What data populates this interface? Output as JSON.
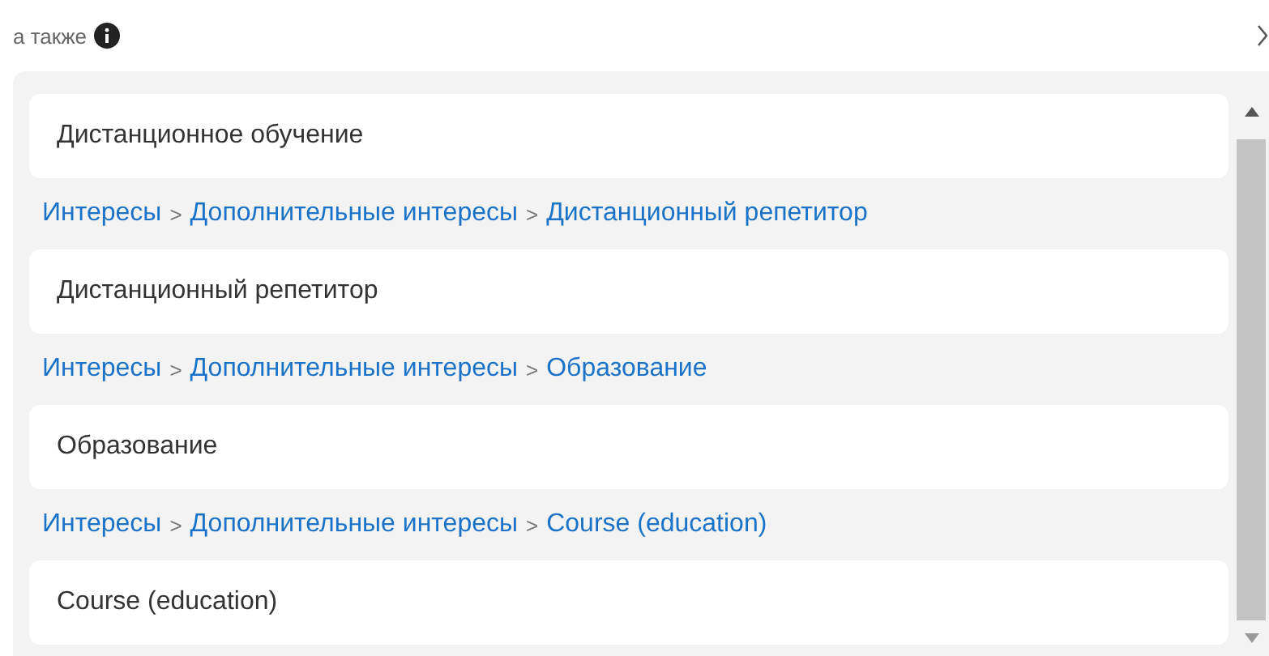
{
  "header": {
    "title": "а также"
  },
  "results": [
    {
      "title": "Дистанционное обучение"
    },
    {
      "path": [
        {
          "kind": "link",
          "text": "Интересы"
        },
        {
          "kind": "sep",
          "text": ">"
        },
        {
          "kind": "link",
          "text": "Дополнительные интересы"
        },
        {
          "kind": "sep",
          "text": ">"
        },
        {
          "kind": "link",
          "text": "Дистанционный репетитор"
        }
      ],
      "title": "Дистанционный репетитор"
    },
    {
      "path": [
        {
          "kind": "link",
          "text": "Интересы"
        },
        {
          "kind": "sep",
          "text": ">"
        },
        {
          "kind": "link",
          "text": "Дополнительные интересы"
        },
        {
          "kind": "sep",
          "text": ">"
        },
        {
          "kind": "link",
          "text": "Образование"
        }
      ],
      "title": "Образование"
    },
    {
      "path": [
        {
          "kind": "link",
          "text": "Интересы"
        },
        {
          "kind": "sep",
          "text": ">"
        },
        {
          "kind": "link",
          "text": "Дополнительные интересы"
        },
        {
          "kind": "sep",
          "text": ">"
        },
        {
          "kind": "link",
          "text": "Course (education)"
        }
      ],
      "title": "Course (education)"
    }
  ]
}
